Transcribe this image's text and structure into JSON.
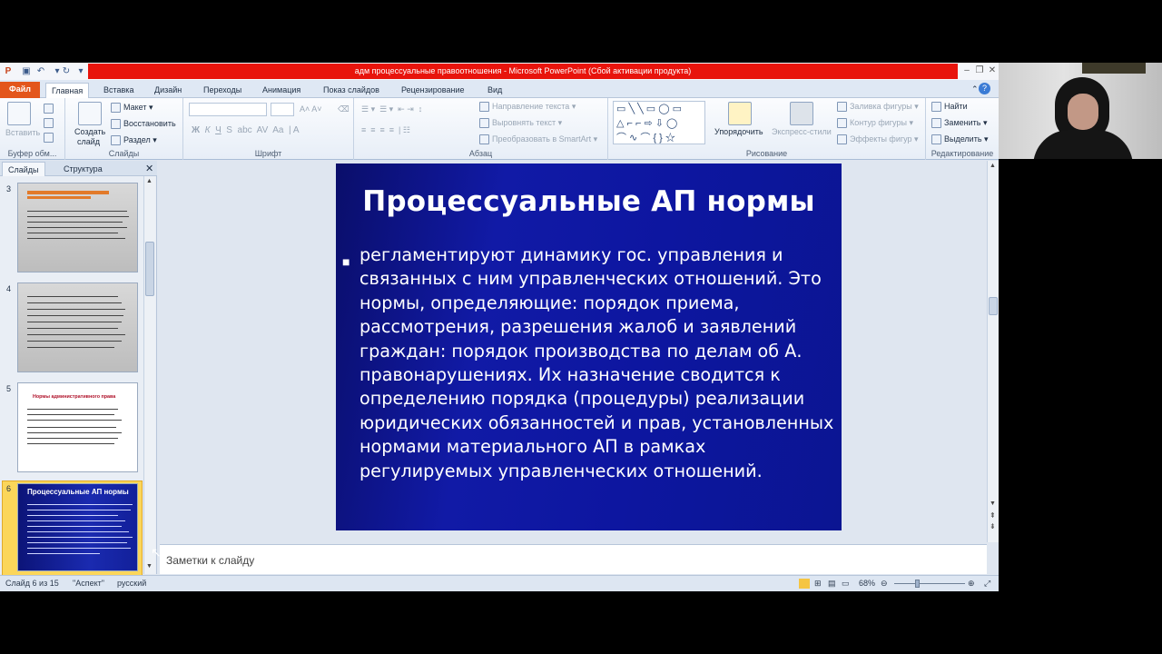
{
  "window": {
    "title": "адм процессуальные правоотношения - Microsoft PowerPoint (Сбой активации продукта)"
  },
  "tabs": [
    {
      "label": "Файл"
    },
    {
      "label": "Главная"
    },
    {
      "label": "Вставка"
    },
    {
      "label": "Дизайн"
    },
    {
      "label": "Переходы"
    },
    {
      "label": "Анимация"
    },
    {
      "label": "Показ слайдов"
    },
    {
      "label": "Рецензирование"
    },
    {
      "label": "Вид"
    }
  ],
  "ribbon": {
    "clipboard": {
      "label": "Буфер обм...",
      "paste": "Вставить"
    },
    "slides": {
      "label": "Слайды",
      "new_slide_1": "Создать",
      "new_slide_2": "слайд",
      "layout": "Макет",
      "reset": "Восстановить",
      "section": "Раздел"
    },
    "font": {
      "label": "Шрифт"
    },
    "paragraph": {
      "label": "Абзац",
      "text_direction": "Направление текста",
      "align_text": "Выровнять текст",
      "smartart": "Преобразовать в SmartArt"
    },
    "drawing": {
      "label": "Рисование",
      "arrange": "Упорядочить",
      "quick_styles": "Экспресс-стили",
      "shape_fill": "Заливка фигуры",
      "shape_outline": "Контур фигуры",
      "shape_effects": "Эффекты фигур"
    },
    "editing": {
      "label": "Редактирование",
      "find": "Найти",
      "replace": "Заменить",
      "select": "Выделить"
    }
  },
  "left_panel": {
    "tab_slides": "Слайды",
    "tab_outline": "Структура",
    "thumbnails": [
      {
        "number": "3"
      },
      {
        "number": "4"
      },
      {
        "number": "5",
        "heading": "Нормы административного права"
      },
      {
        "number": "6",
        "heading": "Процессуальные АП нормы"
      }
    ]
  },
  "slide": {
    "title": "Процессуальные АП нормы",
    "bullet": "регламентируют динамику гос. управления и связанных с ним управленческих отношений. Это нормы, определяющие: порядок приема, рассмотрения, разрешения жалоб и заявлений граждан: порядок производства по делам об А. правонарушениях. Их назначение сводится к определению порядка (процедуры) реализации юридических обязанностей и прав, установленных нормами материального АП в рамках регулируемых управленческих отношений."
  },
  "notes": {
    "placeholder": "Заметки к слайду"
  },
  "status": {
    "slide_info": "Слайд 6 из 15",
    "theme": "\"Аспект\"",
    "language": "русский",
    "zoom": "68%"
  },
  "colors": {
    "title_bar_red": "#e8140c",
    "file_tab": "#e3561c",
    "slide_bg": "#111aa6",
    "selected_thumb": "#fbd65a"
  }
}
